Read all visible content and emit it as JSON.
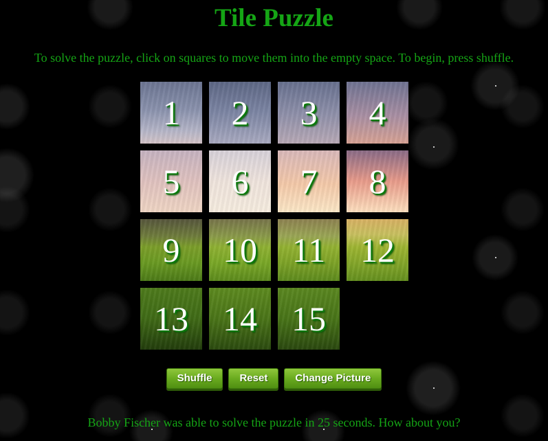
{
  "page": {
    "title": "Tile Puzzle",
    "instructions": "To solve the puzzle, click on squares to move them into the empty space. To begin, press shuffle.",
    "footer_message": "Bobby Fischer was able to solve the puzzle in 25 seconds. How about you?"
  },
  "board": {
    "rows": 4,
    "cols": 4,
    "empty_cell": {
      "row": 4,
      "col": 4
    },
    "tiles": [
      {
        "number": "1",
        "row": 1,
        "col": 1,
        "image_region": "sky1"
      },
      {
        "number": "2",
        "row": 1,
        "col": 2,
        "image_region": "sky1b"
      },
      {
        "number": "3",
        "row": 1,
        "col": 3,
        "image_region": "sky1c"
      },
      {
        "number": "4",
        "row": 1,
        "col": 4,
        "image_region": "sky1d"
      },
      {
        "number": "5",
        "row": 2,
        "col": 1,
        "image_region": "sky2a"
      },
      {
        "number": "6",
        "row": 2,
        "col": 2,
        "image_region": "sky2b"
      },
      {
        "number": "7",
        "row": 2,
        "col": 3,
        "image_region": "sky2c"
      },
      {
        "number": "8",
        "row": 2,
        "col": 4,
        "image_region": "sky2d"
      },
      {
        "number": "9",
        "row": 3,
        "col": 1,
        "image_region": "field1"
      },
      {
        "number": "10",
        "row": 3,
        "col": 2,
        "image_region": "field1b"
      },
      {
        "number": "11",
        "row": 3,
        "col": 3,
        "image_region": "field1c"
      },
      {
        "number": "12",
        "row": 3,
        "col": 4,
        "image_region": "field1d"
      },
      {
        "number": "13",
        "row": 4,
        "col": 1,
        "image_region": "grass1"
      },
      {
        "number": "14",
        "row": 4,
        "col": 2,
        "image_region": "grass2"
      },
      {
        "number": "15",
        "row": 4,
        "col": 3,
        "image_region": "grass3"
      }
    ]
  },
  "controls": {
    "shuffle_label": "Shuffle",
    "reset_label": "Reset",
    "change_picture_label": "Change Picture"
  },
  "colors": {
    "text_green": "#15a515",
    "button_green": "#6aab1f",
    "background": "#000000",
    "tile_number": "#ffffff"
  }
}
